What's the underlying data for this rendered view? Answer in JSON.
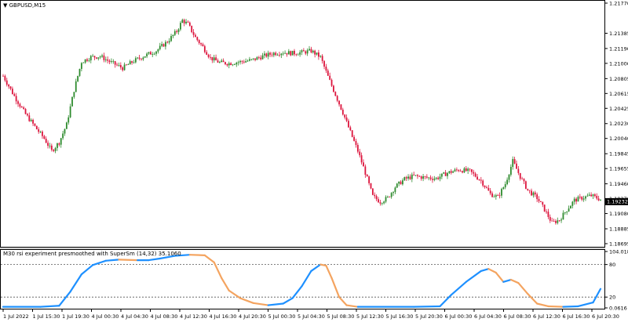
{
  "window": {
    "symbol_label": "GBPUSD,M15",
    "indicator_label": "M30 rsi experiment presmoothed with SuperSm (14,32) 35.1060"
  },
  "price_axis": {
    "ticks": [
      "1.21770",
      "1.21385",
      "1.21190",
      "1.21000",
      "1.20805",
      "1.20615",
      "1.20425",
      "1.20230",
      "1.20040",
      "1.19845",
      "1.19655",
      "1.19460",
      "1.19270",
      "1.19080",
      "1.18885",
      "1.18695"
    ],
    "current_price": "1.19232",
    "ymin": 1.18695,
    "ymax": 1.2177
  },
  "indicator_axis": {
    "ticks": [
      "104.018",
      "80",
      "20",
      "0.0616"
    ],
    "levels": [
      80,
      20
    ],
    "ymin": 0.0616,
    "ymax": 104.018
  },
  "time_axis": {
    "labels": [
      "1 Jul 2022",
      "1 Jul 15:30",
      "1 Jul 19:30",
      "4 Jul 00:30",
      "4 Jul 04:30",
      "4 Jul 08:30",
      "4 Jul 12:30",
      "4 Jul 16:30",
      "4 Jul 20:30",
      "5 Jul 00:30",
      "5 Jul 04:30",
      "5 Jul 08:30",
      "5 Jul 12:30",
      "5 Jul 16:30",
      "5 Jul 20:30",
      "6 Jul 00:30",
      "6 Jul 04:30",
      "6 Jul 08:30",
      "6 Jul 12:30",
      "6 Jul 16:30",
      "6 Jul 20:30"
    ]
  },
  "colors": {
    "bull": "#2e8b2e",
    "bear": "#dc143c",
    "rsi_up": "#1e90ff",
    "rsi_down": "#f4a460",
    "grid": "#e6e6e6",
    "axis": "#000000"
  },
  "chart_data": {
    "type": "line",
    "price_path": [
      [
        0,
        1.2084
      ],
      [
        6,
        1.2058
      ],
      [
        12,
        1.2035
      ],
      [
        18,
        1.2016
      ],
      [
        22,
        1.2004
      ],
      [
        26,
        1.1988
      ],
      [
        30,
        1.1999
      ],
      [
        34,
        1.2022
      ],
      [
        38,
        1.2066
      ],
      [
        42,
        1.2102
      ],
      [
        47,
        1.2108
      ],
      [
        52,
        1.2109
      ],
      [
        58,
        1.2101
      ],
      [
        64,
        1.2094
      ],
      [
        70,
        1.2103
      ],
      [
        76,
        1.211
      ],
      [
        82,
        1.2116
      ],
      [
        88,
        1.2128
      ],
      [
        93,
        1.2141
      ],
      [
        96,
        1.2155
      ],
      [
        99,
        1.215
      ],
      [
        103,
        1.2133
      ],
      [
        107,
        1.2121
      ],
      [
        111,
        1.2107
      ],
      [
        116,
        1.2101
      ],
      [
        121,
        1.21
      ],
      [
        127,
        1.2102
      ],
      [
        133,
        1.2104
      ],
      [
        139,
        1.2109
      ],
      [
        145,
        1.2113
      ],
      [
        150,
        1.2114
      ],
      [
        155,
        1.2113
      ],
      [
        160,
        1.2114
      ],
      [
        165,
        1.2116
      ],
      [
        170,
        1.2108
      ],
      [
        174,
        1.2083
      ],
      [
        178,
        1.206
      ],
      [
        182,
        1.2037
      ],
      [
        186,
        1.2012
      ],
      [
        190,
        1.1988
      ],
      [
        194,
        1.196
      ],
      [
        198,
        1.193
      ],
      [
        202,
        1.1923
      ],
      [
        206,
        1.1928
      ],
      [
        210,
        1.1942
      ],
      [
        215,
        1.1952
      ],
      [
        220,
        1.1956
      ],
      [
        226,
        1.1954
      ],
      [
        232,
        1.1953
      ],
      [
        238,
        1.196
      ],
      [
        244,
        1.1964
      ],
      [
        250,
        1.1962
      ],
      [
        256,
        1.195
      ],
      [
        261,
        1.1933
      ],
      [
        265,
        1.1929
      ],
      [
        269,
        1.1946
      ],
      [
        273,
        1.1975
      ],
      [
        277,
        1.1955
      ],
      [
        281,
        1.1938
      ],
      [
        286,
        1.1928
      ],
      [
        290,
        1.1913
      ],
      [
        294,
        1.1896
      ],
      [
        298,
        1.19
      ],
      [
        302,
        1.1913
      ],
      [
        306,
        1.1925
      ],
      [
        310,
        1.1928
      ],
      [
        315,
        1.1931
      ],
      [
        320,
        1.1926
      ]
    ],
    "rsi_series": {
      "name": "M30 rsi experiment presmoothed with SuperSm (14,32)",
      "values": [
        [
          0,
          2
        ],
        [
          20,
          2
        ],
        [
          30,
          4
        ],
        [
          36,
          30
        ],
        [
          42,
          62
        ],
        [
          48,
          79
        ],
        [
          55,
          87
        ],
        [
          62,
          89
        ],
        [
          72,
          88
        ],
        [
          78,
          88
        ],
        [
          84,
          91
        ],
        [
          92,
          96
        ],
        [
          100,
          98
        ],
        [
          108,
          97
        ],
        [
          113,
          84
        ],
        [
          117,
          55
        ],
        [
          121,
          32
        ],
        [
          127,
          18
        ],
        [
          134,
          9
        ],
        [
          142,
          5
        ],
        [
          150,
          8
        ],
        [
          155,
          18
        ],
        [
          160,
          40
        ],
        [
          165,
          68
        ],
        [
          170,
          80
        ],
        [
          173,
          78
        ],
        [
          176,
          55
        ],
        [
          180,
          20
        ],
        [
          184,
          5
        ],
        [
          190,
          2
        ],
        [
          220,
          2
        ],
        [
          234,
          3
        ],
        [
          240,
          24
        ],
        [
          248,
          48
        ],
        [
          256,
          68
        ],
        [
          260,
          72
        ],
        [
          264,
          65
        ],
        [
          268,
          48
        ],
        [
          272,
          52
        ],
        [
          276,
          46
        ],
        [
          281,
          26
        ],
        [
          286,
          8
        ],
        [
          292,
          3
        ],
        [
          300,
          2
        ],
        [
          308,
          3
        ],
        [
          316,
          10
        ],
        [
          320,
          35.1
        ]
      ]
    }
  }
}
